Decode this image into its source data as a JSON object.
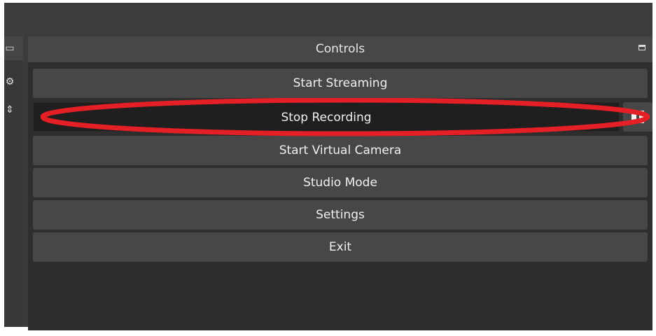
{
  "controls_panel": {
    "title": "Controls",
    "buttons": [
      {
        "label": "Start Streaming"
      },
      {
        "label": "Stop Recording"
      },
      {
        "label": "Start Virtual Camera"
      },
      {
        "label": "Studio Mode"
      },
      {
        "label": "Settings"
      },
      {
        "label": "Exit"
      }
    ]
  },
  "icons": {
    "float": "undock-icon",
    "pause": "pause-icon",
    "gear": "gear-icon",
    "swap": "chevron-updown-icon"
  },
  "colors": {
    "panel_bg": "#2e2e2e",
    "button_bg": "#474747",
    "active_button_bg": "#1f1f1f",
    "annotation": "#e41f26"
  }
}
